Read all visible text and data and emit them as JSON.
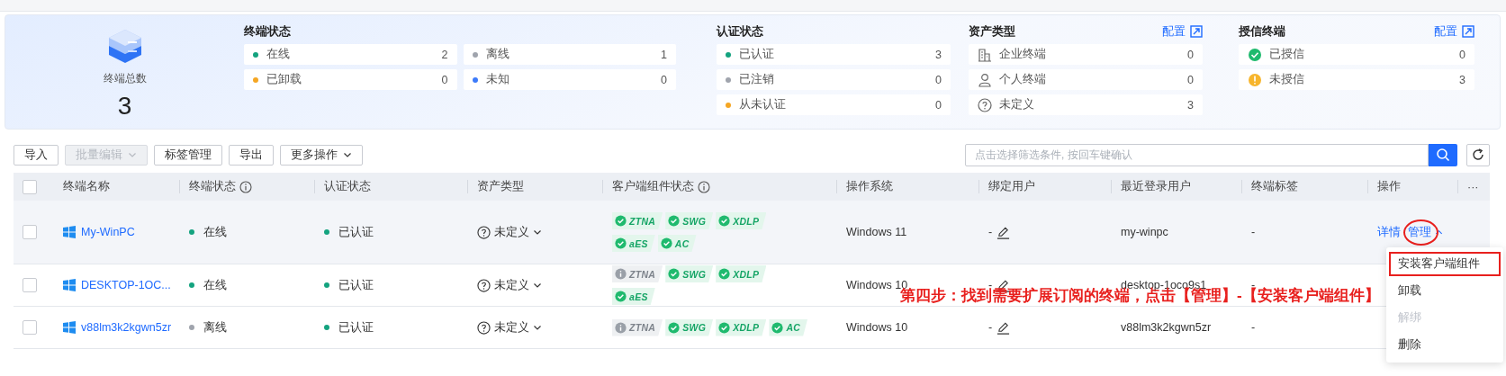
{
  "summary": {
    "label": "终端总数",
    "value": "3"
  },
  "stat_groups": [
    {
      "title": "终端状态",
      "items": [
        {
          "kind": "dot",
          "color": "#14a37f",
          "label": "在线",
          "count": "2"
        },
        {
          "kind": "dot",
          "color": "#a0a4ad",
          "label": "离线",
          "count": "1"
        },
        {
          "kind": "dot",
          "color": "#f5a623",
          "label": "已卸载",
          "count": "0"
        },
        {
          "kind": "dot",
          "color": "#3d7bfa",
          "label": "未知",
          "count": "0"
        }
      ]
    },
    {
      "title": "认证状态",
      "items": [
        {
          "kind": "dot",
          "color": "#14a37f",
          "label": "已认证",
          "count": "3"
        },
        {
          "kind": "dot",
          "color": "#a0a4ad",
          "label": "已注销",
          "count": "0"
        },
        {
          "kind": "dot",
          "color": "#f5a623",
          "label": "从未认证",
          "count": "0"
        }
      ]
    },
    {
      "title": "资产类型",
      "link": "配置",
      "items": [
        {
          "kind": "building",
          "label": "企业终端",
          "count": "0"
        },
        {
          "kind": "person",
          "label": "个人终端",
          "count": "0"
        },
        {
          "kind": "question",
          "label": "未定义",
          "count": "3"
        }
      ]
    },
    {
      "title": "授信终端",
      "link": "配置",
      "items": [
        {
          "kind": "check",
          "label": "已授信",
          "count": "0"
        },
        {
          "kind": "warning",
          "label": "未授信",
          "count": "3"
        }
      ]
    }
  ],
  "toolbar": [
    {
      "label": "导入",
      "disabled": false,
      "dropdown": false
    },
    {
      "label": "批量编辑",
      "disabled": true,
      "dropdown": true
    },
    {
      "label": "标签管理",
      "disabled": false,
      "dropdown": false
    },
    {
      "label": "导出",
      "disabled": false,
      "dropdown": false
    },
    {
      "label": "更多操作",
      "disabled": false,
      "dropdown": true
    }
  ],
  "search": {
    "placeholder": "点击选择筛选条件, 按回车键确认"
  },
  "table": {
    "header_checked": false,
    "columns": [
      {
        "label": "终端名称"
      },
      {
        "label": "终端状态",
        "info": true
      },
      {
        "label": "认证状态"
      },
      {
        "label": "资产类型"
      },
      {
        "label": "客户端组件状态",
        "info": true
      },
      {
        "label": "操作系统"
      },
      {
        "label": "绑定用户"
      },
      {
        "label": "最近登录用户"
      },
      {
        "label": "终端标签"
      },
      {
        "label": "操作"
      },
      {
        "label": "···"
      }
    ],
    "rows": [
      {
        "checked": false,
        "highlighted": true,
        "name": "My-WinPC",
        "status": {
          "label": "在线",
          "color": "#14a37f"
        },
        "auth": {
          "label": "已认证",
          "color": "#14a37f"
        },
        "asset": "未定义",
        "components": [
          {
            "name": "ZTNA",
            "installed": true
          },
          {
            "name": "SWG",
            "installed": true
          },
          {
            "name": "XDLP",
            "installed": true
          },
          {
            "name": "aES",
            "installed": true
          },
          {
            "name": "AC",
            "installed": true
          }
        ],
        "os": "Windows 11",
        "bound_user": "-",
        "last_user": "my-winpc",
        "tag": "-",
        "actions": [
          {
            "label": "详情",
            "menu": false,
            "annotated": false
          },
          {
            "label": "管理",
            "menu": true,
            "expanded": true,
            "annotated": true
          }
        ]
      },
      {
        "checked": false,
        "highlighted": false,
        "name": "DESKTOP-1OC...",
        "status": {
          "label": "在线",
          "color": "#14a37f"
        },
        "auth": {
          "label": "已认证",
          "color": "#14a37f"
        },
        "asset": "未定义",
        "components": [
          {
            "name": "ZTNA",
            "installed": false
          },
          {
            "name": "SWG",
            "installed": true
          },
          {
            "name": "XDLP",
            "installed": true
          },
          {
            "name": "aES",
            "installed": true
          }
        ],
        "os": "Windows 10",
        "bound_user": "-",
        "last_user": "desktop-1oco9s1",
        "tag": "-",
        "actions": []
      },
      {
        "checked": false,
        "highlighted": false,
        "name": "v88lm3k2kgwn5zr",
        "status": {
          "label": "离线",
          "color": "#a0a4ad"
        },
        "auth": {
          "label": "已认证",
          "color": "#14a37f"
        },
        "asset": "未定义",
        "components": [
          {
            "name": "ZTNA",
            "installed": false
          },
          {
            "name": "SWG",
            "installed": true
          },
          {
            "name": "XDLP",
            "installed": true
          },
          {
            "name": "AC",
            "installed": true
          }
        ],
        "os": "Windows 10",
        "bound_user": "-",
        "last_user": "v88lm3k2kgwn5zr",
        "tag": "-",
        "actions": []
      }
    ]
  },
  "menu": {
    "items": [
      {
        "label": "安装客户端组件",
        "disabled": false,
        "annotated": true
      },
      {
        "label": "卸载",
        "disabled": false,
        "annotated": false
      },
      {
        "label": "解绑",
        "disabled": true,
        "annotated": false
      },
      {
        "label": "删除",
        "disabled": false,
        "annotated": false
      }
    ]
  },
  "annotation": {
    "text": "第四步：找到需要扩展订阅的终端，点击【管理】-【安装客户端组件】"
  }
}
